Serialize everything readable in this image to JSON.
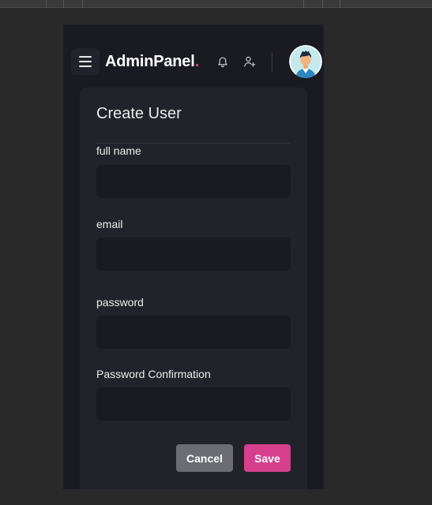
{
  "header": {
    "brand_name": "AdminPanel",
    "brand_dot": ".",
    "icons": {
      "menu": "hamburger-menu-icon",
      "notifications": "bell-icon",
      "add_user": "user-plus-icon",
      "avatar": "user-avatar"
    }
  },
  "form": {
    "title": "Create User",
    "fields": [
      {
        "label": "full name",
        "value": "",
        "placeholder": ""
      },
      {
        "label": "email",
        "value": "",
        "placeholder": ""
      },
      {
        "label": "password",
        "value": "",
        "placeholder": ""
      },
      {
        "label": "Password Confirmation",
        "value": "",
        "placeholder": ""
      }
    ],
    "cancel_label": "Cancel",
    "save_label": "Save"
  },
  "colors": {
    "accent": "#d63f8c",
    "brand_dot": "#e0457b",
    "cancel_button": "#6c6d73",
    "panel_bg": "#1a1b21",
    "card_bg": "#22232a"
  }
}
